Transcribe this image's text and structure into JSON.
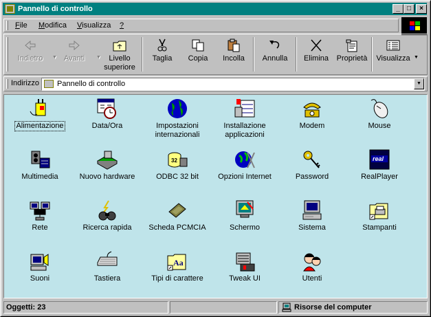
{
  "window": {
    "title": "Pannello di controllo"
  },
  "menu": [
    {
      "label": "File",
      "accel": "F",
      "rest": "ile"
    },
    {
      "label": "Modifica",
      "accel": "M",
      "rest": "odifica"
    },
    {
      "label": "Visualizza",
      "accel": "V",
      "rest": "isualizza"
    },
    {
      "label": "?",
      "accel": "?",
      "rest": ""
    }
  ],
  "toolbar": {
    "back": "Indietro",
    "forward": "Avanti",
    "up_line1": "Livello",
    "up_line2": "superiore",
    "cut": "Taglia",
    "copy": "Copia",
    "paste": "Incolla",
    "undo": "Annulla",
    "delete": "Elimina",
    "properties": "Proprietà",
    "views": "Visualizza"
  },
  "address": {
    "label": "Indirizzo",
    "value": "Pannello di controllo"
  },
  "items": [
    {
      "label": "Alimentazione"
    },
    {
      "label": "Data/Ora"
    },
    {
      "label": "Impostazioni internazionali",
      "l1": "Impostazioni",
      "l2": "internazionali"
    },
    {
      "label": "Installazione applicazioni",
      "l1": "Installazione",
      "l2": "applicazioni"
    },
    {
      "label": "Modem"
    },
    {
      "label": "Mouse"
    },
    {
      "label": "Multimedia"
    },
    {
      "label": "Nuovo hardware"
    },
    {
      "label": "ODBC 32 bit"
    },
    {
      "label": "Opzioni Internet"
    },
    {
      "label": "Password"
    },
    {
      "label": "RealPlayer"
    },
    {
      "label": "Rete"
    },
    {
      "label": "Ricerca rapida"
    },
    {
      "label": "Scheda PCMCIA"
    },
    {
      "label": "Schermo"
    },
    {
      "label": "Sistema"
    },
    {
      "label": "Stampanti"
    },
    {
      "label": "Suoni"
    },
    {
      "label": "Tastiera"
    },
    {
      "label": "Tipi di carattere"
    },
    {
      "label": "Tweak UI"
    },
    {
      "label": "Utenti"
    }
  ],
  "status": {
    "objects": "Oggetti: 23",
    "location": "Risorse del computer"
  },
  "colors": {
    "title_bar": "#008080",
    "content_bg": "#bfe4ea",
    "chrome": "#c0c0c0"
  }
}
